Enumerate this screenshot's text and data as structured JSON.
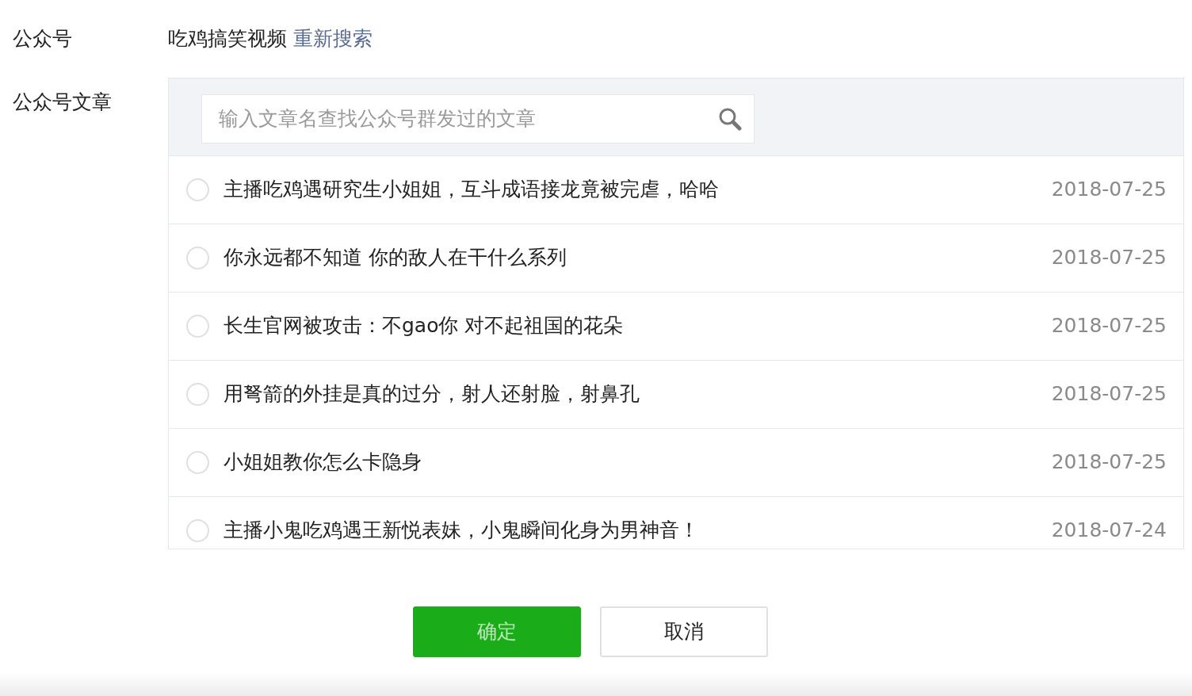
{
  "account": {
    "label": "公众号",
    "name": "吃鸡搞笑视频",
    "research_link": "重新搜索"
  },
  "articles_section": {
    "label": "公众号文章",
    "search": {
      "placeholder": "输入文章名查找公众号群发过的文章"
    },
    "rows": [
      {
        "title": "主播吃鸡遇研究生小姐姐，互斗成语接龙竟被完虐，哈哈",
        "date": "2018-07-25",
        "selected": false
      },
      {
        "title": "你永远都不知道 你的敌人在干什么系列",
        "date": "2018-07-25",
        "selected": false
      },
      {
        "title": "长生官网被攻击：不gao你 对不起祖国的花朵",
        "date": "2018-07-25",
        "selected": false
      },
      {
        "title": "用弩箭的外挂是真的过分，射人还射脸，射鼻孔",
        "date": "2018-07-25",
        "selected": false
      },
      {
        "title": "小姐姐教你怎么卡隐身",
        "date": "2018-07-25",
        "selected": false
      },
      {
        "title": "主播小鬼吃鸡遇王新悦表妹，小鬼瞬间化身为男神音！",
        "date": "2018-07-24",
        "selected": false
      }
    ]
  },
  "buttons": [
    {
      "kind": "primary",
      "label": "确定",
      "disabled": true
    },
    {
      "kind": "default",
      "label": "取消",
      "disabled": false
    }
  ]
}
